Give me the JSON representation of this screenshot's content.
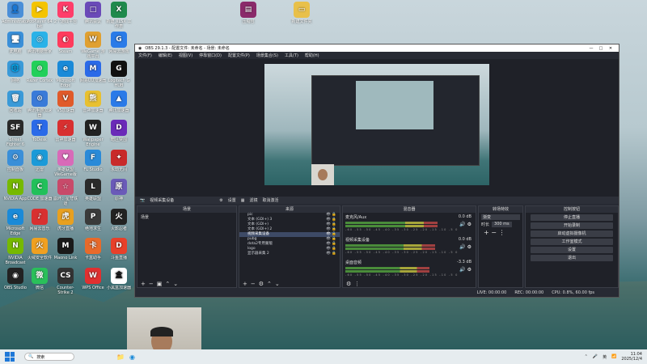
{
  "desktop": {
    "icons": [
      {
        "label": "Administrator",
        "color": "#4a8fd8",
        "glyph": "👤"
      },
      {
        "label": "PotPlayer 64 bit",
        "color": "#f4c400",
        "glyph": "▶"
      },
      {
        "label": "2个游戏平台",
        "color": "#ff3d6a",
        "glyph": "K"
      },
      {
        "label": "腾讯会议",
        "color": "#6a4ab8",
        "glyph": "□"
      },
      {
        "label": "新建 XLSX 工作表",
        "color": "#1f8a4c",
        "glyph": "X"
      },
      {
        "label": "此电脑",
        "color": "#3a8fd8",
        "glyph": "🖥"
      },
      {
        "label": "腾讯电脑管家",
        "color": "#2ab2e8",
        "glyph": "◎"
      },
      {
        "label": "Steam",
        "color": "#ff3b5c",
        "glyph": "◐"
      },
      {
        "label": "WeGame 游戏平台",
        "color": "#e0a030",
        "glyph": "W"
      },
      {
        "label": "网易云游戏",
        "color": "#2a7be8",
        "glyph": "G"
      },
      {
        "label": "网络",
        "color": "#3a9ad8",
        "glyph": "🌐"
      },
      {
        "label": "Razer Cortex",
        "color": "#22d05a",
        "glyph": "⊕"
      },
      {
        "label": "Microsoft Edge",
        "color": "#1a8ad8",
        "glyph": "e"
      },
      {
        "label": "网易UU加速器",
        "color": "#2a6ae8",
        "glyph": "M"
      },
      {
        "label": "Logitech G HUB",
        "color": "#111",
        "glyph": "G"
      },
      {
        "label": "回收站",
        "color": "#3a9ad8",
        "glyph": "🗑"
      },
      {
        "label": "腾讯手游加速器",
        "color": "#3a7ad8",
        "glyph": "⊙"
      },
      {
        "label": "VS加速器",
        "color": "#e05a2a",
        "glyph": "V"
      },
      {
        "label": "雷神加速器",
        "color": "#e8c030",
        "glyph": "熊"
      },
      {
        "label": "腾讯加速器",
        "color": "#2a7ae8",
        "glyph": "▲"
      },
      {
        "label": "Street Fighter 6",
        "color": "#2a2a2a",
        "glyph": "SF"
      },
      {
        "label": "ToDesk",
        "color": "#2a6ae8",
        "glyph": "T"
      },
      {
        "label": "雷神加速器",
        "color": "#d83030",
        "glyph": "⚡"
      },
      {
        "label": "Wallpaper Engine",
        "color": "#222",
        "glyph": "W"
      },
      {
        "label": "暗区突围",
        "color": "#6a2ab8",
        "glyph": "D"
      },
      {
        "label": "控制面板",
        "color": "#3a8fd8",
        "glyph": "⚙"
      },
      {
        "label": "迅雷",
        "color": "#1a9ad8",
        "glyph": "◉"
      },
      {
        "label": "英雄联盟WeGame版",
        "color": "#d86ab8",
        "glyph": "♥"
      },
      {
        "label": "FL Studio",
        "color": "#2a8ad8",
        "glyph": "F"
      },
      {
        "label": "永劫无间",
        "color": "#c82a2a",
        "glyph": "✦"
      },
      {
        "label": "NVIDIA App",
        "color": "#76b900",
        "glyph": "N"
      },
      {
        "label": "CODE 加速器",
        "color": "#22c05a",
        "glyph": "C"
      },
      {
        "label": "崩坏：星穹铁道",
        "color": "#c84a6a",
        "glyph": "☆"
      },
      {
        "label": "英雄联盟",
        "color": "#2a2a2a",
        "glyph": "L"
      },
      {
        "label": "原神",
        "color": "#6a5ab8",
        "glyph": "原"
      },
      {
        "label": "Microsoft Edge",
        "color": "#1a8ad8",
        "glyph": "e"
      },
      {
        "label": "网易云音乐",
        "color": "#d83030",
        "glyph": "♪"
      },
      {
        "label": "虎牙直播",
        "color": "#e8a020",
        "glyph": "虎"
      },
      {
        "label": "绝地求生",
        "color": "#3a3a3a",
        "glyph": "P"
      },
      {
        "label": "火影忍者",
        "color": "#222",
        "glyph": "火"
      },
      {
        "label": "NVIDIA Broadcast",
        "color": "#76b900",
        "glyph": "N"
      },
      {
        "label": "火绒安全软件",
        "color": "#f0a020",
        "glyph": "火"
      },
      {
        "label": "Maono Link",
        "color": "#1a1a1a",
        "glyph": "M"
      },
      {
        "label": "卡盒助手",
        "color": "#e86a2a",
        "glyph": "卡"
      },
      {
        "label": "斗鱼直播",
        "color": "#e8402a",
        "glyph": "D"
      },
      {
        "label": "OBS Studio",
        "color": "#222",
        "glyph": "◉"
      },
      {
        "label": "微信",
        "color": "#2ac05a",
        "glyph": "微"
      },
      {
        "label": "Counter-Strike 2",
        "color": "#333",
        "glyph": "CS"
      },
      {
        "label": "WPS Office",
        "color": "#e03030",
        "glyph": "W"
      },
      {
        "label": "小黑盒加速器",
        "color": "#fff",
        "glyph": "盒"
      }
    ],
    "top_files": [
      {
        "label": "压缩包",
        "color": "#8a2a6a",
        "glyph": "▤"
      },
      {
        "label": "新建文件夹",
        "color": "#e8c04a",
        "glyph": "▭"
      }
    ]
  },
  "obs": {
    "title": "OBS 29.1.3 - 配置文件: 未命名 - 场景: 未命名",
    "menu": [
      "文件(F)",
      "编辑(E)",
      "视图(V)",
      "停靠窗口(D)",
      "配置文件(P)",
      "场景集合(S)",
      "工具(T)",
      "帮助(H)"
    ],
    "control_bar": {
      "source": "视频采集设备",
      "settings": "设置",
      "filters": "滤镜",
      "deactivate": "取消激活"
    },
    "docks": {
      "scenes": {
        "title": "场景",
        "items": [
          "场景"
        ]
      },
      "sources": {
        "title": "来源",
        "items": [
          "pic",
          "文本 (GDI+) 3",
          "文本 (GDI+)",
          "文本 (GDI+) 2",
          "视频采集设备",
          "pubg",
          "dota2专用蒙版",
          "logo",
          "显示器采集 2"
        ],
        "selected": 4
      },
      "mixer": {
        "title": "混音器",
        "channels": [
          {
            "name": "麦克风/Aux",
            "db": "0.0 dB",
            "level": 0.72
          },
          {
            "name": "视频采集设备",
            "db": "0.0 dB",
            "level": 0.7
          },
          {
            "name": "桌面音频",
            "db": "-3.3 dB",
            "level": 0.66
          }
        ],
        "scale": "-60 -55 -50 -45 -40 -35 -30 -25 -20 -15 -10 -5 0"
      },
      "transitions": {
        "title": "转场特效",
        "type": "渐变",
        "duration_label": "时长",
        "duration": "300 ms"
      },
      "controls": {
        "title": "控制按钮",
        "buttons": [
          "停止直播",
          "开始录制",
          "启动虚拟摄像机",
          "工作室模式",
          "设置",
          "退出"
        ]
      }
    },
    "status": {
      "live": "LIVE: 00:00:00",
      "rec": "REC: 00:00:00",
      "cpu": "CPU: 0.8%, 60.00 fps"
    }
  },
  "taskbar": {
    "search_placeholder": "搜索",
    "lang": "英",
    "time": "11:04",
    "date": "2025/12/4"
  }
}
